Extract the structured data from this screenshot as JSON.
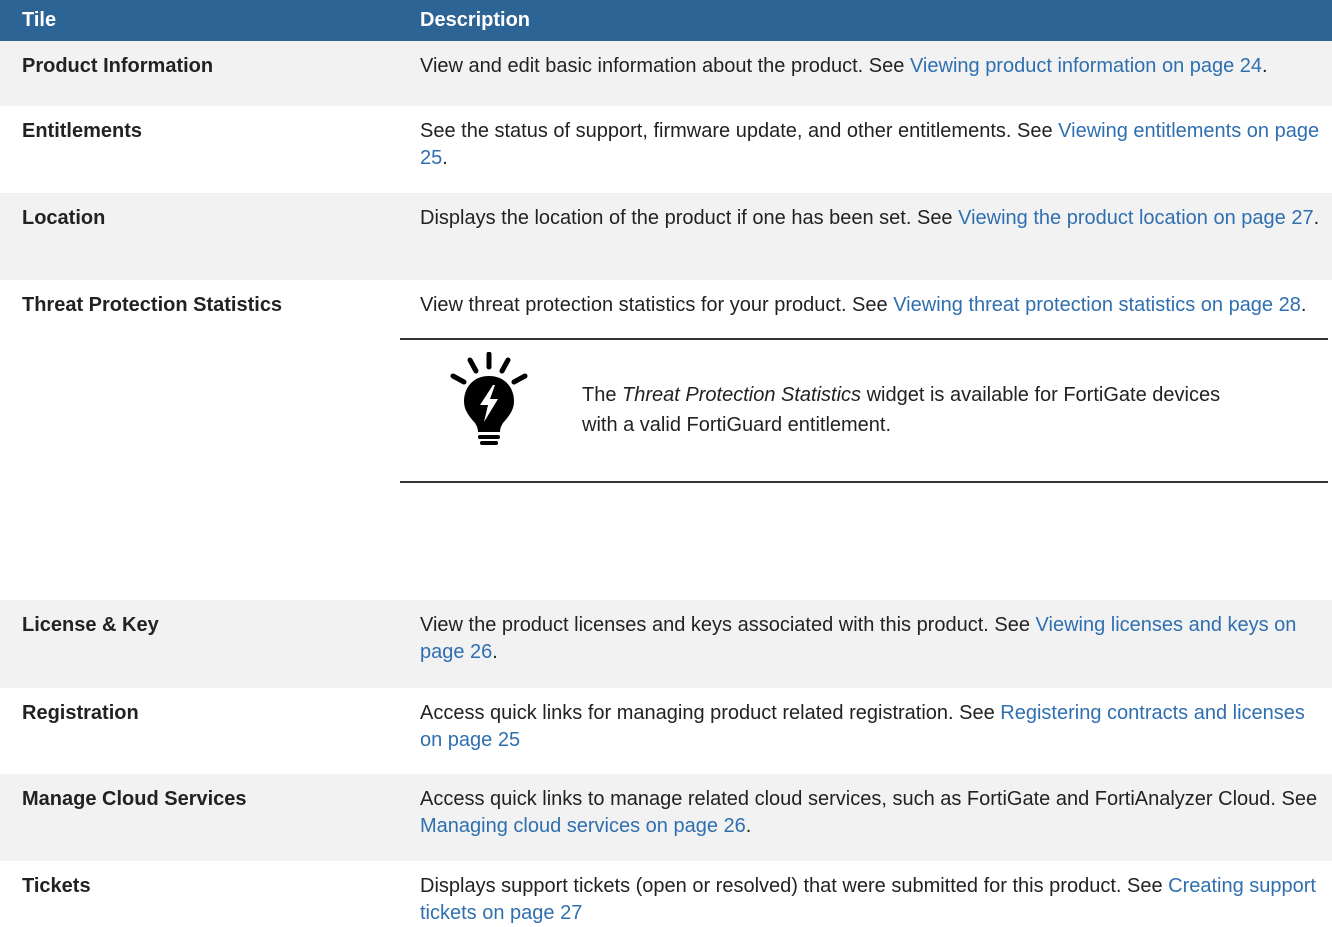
{
  "table": {
    "headers": {
      "tile": "Tile",
      "description": "Description"
    },
    "rows": [
      {
        "tile": "Product Information",
        "text": "View and edit basic information about the product. See ",
        "link": "Viewing product information on page 24",
        "after": "."
      },
      {
        "tile": "Entitlements",
        "text": "See the status of support, firmware update, and other entitlements. See ",
        "link": "Viewing entitlements on page 25",
        "after": "."
      },
      {
        "tile": "Location",
        "text": "Displays the location of the product if one has been set. See ",
        "link": "Viewing the product location on page 27",
        "after": "."
      },
      {
        "tile": "Threat Protection Statistics",
        "text": "View threat protection statistics for your product. See ",
        "link": "Viewing threat protection statistics on page 28",
        "after": "."
      },
      {
        "tile": "License & Key",
        "text": "View the product licenses and keys associated with this product. See ",
        "link": "Viewing licenses and keys on page 26",
        "after": "."
      },
      {
        "tile": "Registration",
        "text": "Access quick links for managing product related registration. See ",
        "link": "Registering contracts and licenses on page 25",
        "after": ""
      },
      {
        "tile": "Manage Cloud Services",
        "text": "Access quick links to manage related cloud services, such as FortiGate and FortiAnalyzer Cloud. See ",
        "link": "Managing cloud services on page 26",
        "after": "."
      },
      {
        "tile": "Tickets",
        "text": "Displays support tickets (open or resolved) that were submitted for this product. See ",
        "link": "Creating support tickets on page 27",
        "after": ""
      }
    ],
    "note": {
      "icon": "lightbulb-icon",
      "prefix": "The ",
      "emphasis": "Threat Protection Statistics",
      "rest": " widget is available for FortiGate devices with a valid FortiGuard entitlement."
    }
  },
  "colors": {
    "header_bg": "#2d6496",
    "link": "#2f6fb0",
    "stripe": "#f2f2f2"
  }
}
